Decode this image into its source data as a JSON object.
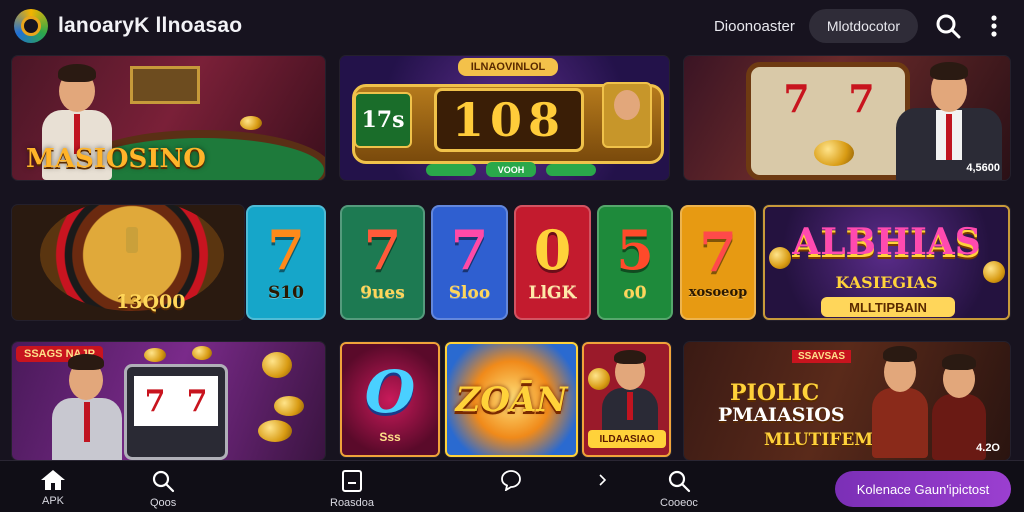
{
  "header": {
    "brand": "lanoaryK llnoasao",
    "link": "Dioonoaster",
    "pill": "Mlotdocotor"
  },
  "tiles": {
    "table_game": {
      "title": "MASIOSINO"
    },
    "slot_counter": {
      "banner": "ILNAOVINLOL",
      "left": "17s",
      "digits": "108",
      "plate": "VOOH"
    },
    "slot_machine": {
      "badge": "4,5600"
    },
    "roulette": {
      "value": "13Q00"
    },
    "sevens": [
      {
        "big": "7",
        "sub": "S10",
        "bg": "#16a6c9"
      },
      {
        "big": "7",
        "sub": "9ues",
        "bg": "#1d7a52"
      },
      {
        "big": "7",
        "sub": "Sloo",
        "bg": "#2f5fd0"
      },
      {
        "big": "0",
        "sub": "LlGK",
        "bg": "#c31b2e"
      },
      {
        "big": "5",
        "sub": "o0",
        "bg": "#1e8a3b"
      },
      {
        "big": "7",
        "sub": "xosoeop",
        "bg": "#e79a12"
      }
    ],
    "alphas": {
      "title": "ALBHIAS",
      "sub": "KASIEGIAS",
      "plate": "MLLTIPBAIN"
    },
    "coins_slot": {
      "badge": "SSAGS NAJP"
    },
    "o_tile": {
      "big": "O",
      "sub": "Sss"
    },
    "zoan": {
      "title": "ZOĀN"
    },
    "portrait": {
      "plate": "ILDAASIAO"
    },
    "promo": {
      "badge": "SSAVSAS",
      "line1": "PIOLIC",
      "line2": "PMAIASIOS",
      "line3": "MLUTIFEMUNM",
      "corner": "4.2O"
    }
  },
  "bottom_nav": {
    "items": [
      {
        "label": "APK",
        "icon": "home-icon"
      },
      {
        "label": "Qoos",
        "icon": "search-icon"
      },
      {
        "label": "Roasdoa",
        "icon": "note-icon"
      },
      {
        "label": "",
        "icon": "chat-icon"
      },
      {
        "label": "",
        "icon": "chevron-right-icon"
      },
      {
        "label": "Cooeoc",
        "icon": "search-icon"
      }
    ],
    "cta": "Kolenace Gaun'ipictost"
  },
  "colors": {
    "background": "#17131f",
    "accent": "#8e38c6"
  }
}
